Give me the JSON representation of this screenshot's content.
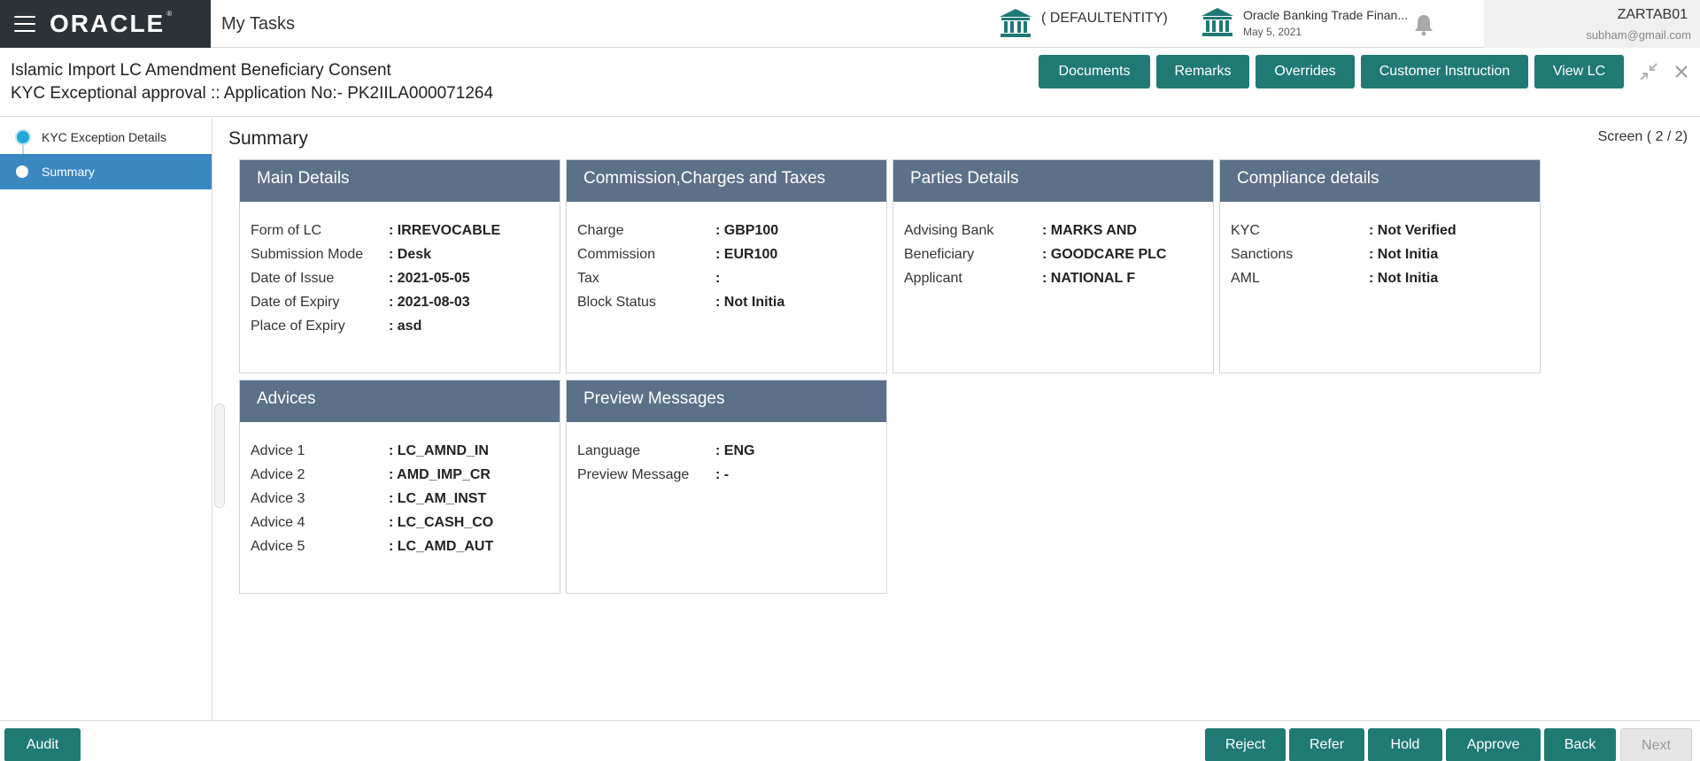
{
  "topbar": {
    "logo": "ORACLE",
    "app_title": "My Tasks",
    "entity": "( DEFAULTENTITY)",
    "branch_name": "Oracle Banking Trade Finan...",
    "branch_date": "May 5, 2021",
    "user_id": "ZARTAB01",
    "user_email": "subham@gmail.com",
    "icons": [
      "menu-icon",
      "bank-icon",
      "bell-icon"
    ]
  },
  "header": {
    "title": "Islamic Import LC Amendment Beneficiary Consent",
    "subtitle": "KYC Exceptional approval ::  Application No:- PK2IILA000071264",
    "buttons": [
      "Documents",
      "Remarks",
      "Overrides",
      "Customer Instruction",
      "View LC"
    ],
    "button_color": "#1f7a73"
  },
  "sidebar": {
    "items": [
      {
        "label": "KYC Exception Details",
        "active": false
      },
      {
        "label": "Summary",
        "active": true
      }
    ],
    "active_color": "#3a87c2"
  },
  "main": {
    "title": "Summary",
    "screen": "Screen ( 2 / 2)",
    "card_header_color": "#5c7089",
    "cards": [
      {
        "title": "Main Details",
        "rows": [
          {
            "k": "Form of LC",
            "v": ": IRREVOCABLE"
          },
          {
            "k": "Submission Mode",
            "v": ": Desk"
          },
          {
            "k": "Date of Issue",
            "v": ": 2021-05-05"
          },
          {
            "k": "Date of Expiry",
            "v": ": 2021-08-03"
          },
          {
            "k": "Place of Expiry",
            "v": ": asd"
          }
        ]
      },
      {
        "title": "Commission,Charges and Taxes",
        "rows": [
          {
            "k": "Charge",
            "v": ": GBP100"
          },
          {
            "k": "Commission",
            "v": ": EUR100"
          },
          {
            "k": "Tax",
            "v": ":"
          },
          {
            "k": "Block Status",
            "v": ": Not Initia"
          }
        ]
      },
      {
        "title": "Parties Details",
        "rows": [
          {
            "k": "Advising Bank",
            "v": ": MARKS AND"
          },
          {
            "k": "Beneficiary",
            "v": ": GOODCARE PLC"
          },
          {
            "k": "Applicant",
            "v": ": NATIONAL F"
          }
        ]
      },
      {
        "title": "Compliance details",
        "rows": [
          {
            "k": "KYC",
            "v": ": Not Verified"
          },
          {
            "k": "Sanctions",
            "v": ": Not Initia"
          },
          {
            "k": "AML",
            "v": ": Not Initia"
          }
        ]
      },
      {
        "title": "Advices",
        "rows": [
          {
            "k": "Advice 1",
            "v": ": LC_AMND_IN"
          },
          {
            "k": "Advice 2",
            "v": ": AMD_IMP_CR"
          },
          {
            "k": "Advice 3",
            "v": ": LC_AM_INST"
          },
          {
            "k": "Advice 4",
            "v": ": LC_CASH_CO"
          },
          {
            "k": "Advice 5",
            "v": ": LC_AMD_AUT"
          }
        ]
      },
      {
        "title": "Preview Messages",
        "rows": [
          {
            "k": "Language",
            "v": ": ENG"
          },
          {
            "k": "Preview Message",
            "v": ": -"
          }
        ]
      }
    ]
  },
  "footer": {
    "audit": "Audit",
    "buttons": [
      {
        "label": "Reject",
        "disabled": false
      },
      {
        "label": "Refer",
        "disabled": false
      },
      {
        "label": "Hold",
        "disabled": false
      },
      {
        "label": "Approve",
        "disabled": false
      },
      {
        "label": "Back",
        "disabled": false
      },
      {
        "label": "Next",
        "disabled": true
      }
    ]
  }
}
